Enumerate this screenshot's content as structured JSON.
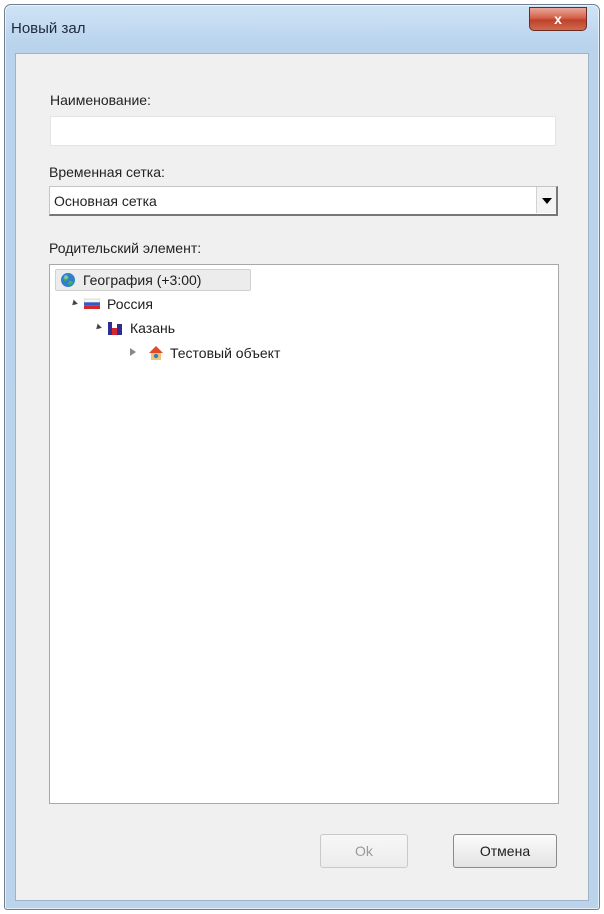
{
  "window": {
    "title": "Новый зал",
    "close_label": "x"
  },
  "form": {
    "name_label": "Наименование:",
    "name_value": "",
    "grid_label": "Временная сетка:",
    "grid_value": "Основная сетка",
    "parent_label": "Родительский элемент:"
  },
  "tree": {
    "items": [
      {
        "label": "География (+3:00)",
        "icon": "globe-icon",
        "selected": true
      },
      {
        "label": "Россия",
        "icon": "russia-flag-icon",
        "expanded": true
      },
      {
        "label": "Казань",
        "icon": "city-icon",
        "expanded": true
      },
      {
        "label": "Тестовый объект",
        "icon": "building-icon",
        "expanded": false
      }
    ]
  },
  "buttons": {
    "ok_label": "Ok",
    "cancel_label": "Отмена"
  }
}
